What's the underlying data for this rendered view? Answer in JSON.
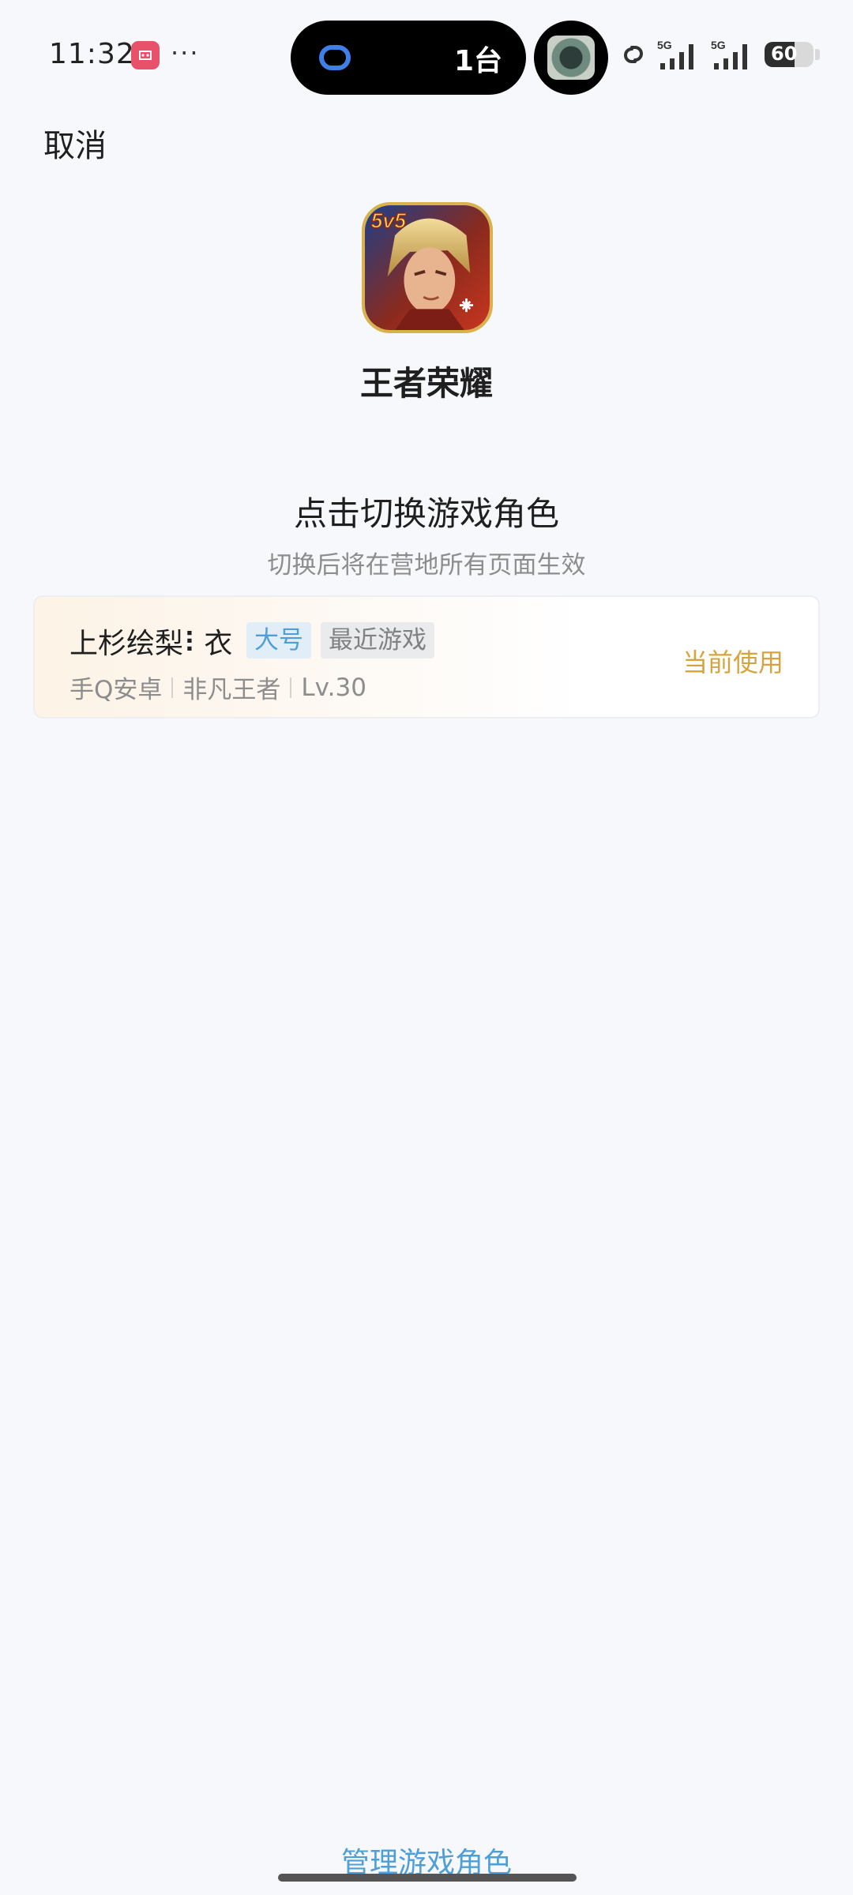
{
  "status_bar": {
    "time": "11:32",
    "more": "···",
    "island_count": "1台",
    "battery_level": "60",
    "signal_1": "5G",
    "signal_2": "5G",
    "icons": [
      "app-notification-icon",
      "link-icon",
      "camera-eye-icon",
      "link-icon",
      "signal-5g-icon",
      "signal-5g-icon",
      "battery-icon"
    ]
  },
  "header": {
    "cancel_label": "取消"
  },
  "game": {
    "name": "王者荣耀",
    "icon_badge": "5v5"
  },
  "prompt": {
    "title": "点击切换游戏角色",
    "subtitle": "切换后将在营地所有页面生效"
  },
  "roles": [
    {
      "name": "上杉绘梨⠇衣",
      "tags": [
        "大号",
        "最近游戏"
      ],
      "platform": "手Q安卓",
      "rank": "非凡王者",
      "level": "Lv.30",
      "status": "当前使用"
    }
  ],
  "footer": {
    "manage_label": "管理游戏角色"
  },
  "colors": {
    "background": "#f6f8fc",
    "accent_blue": "#4f9fd6",
    "accent_gold": "#d6a43f",
    "text_primary": "#1f1f1f",
    "text_secondary": "#8d8d8d"
  }
}
